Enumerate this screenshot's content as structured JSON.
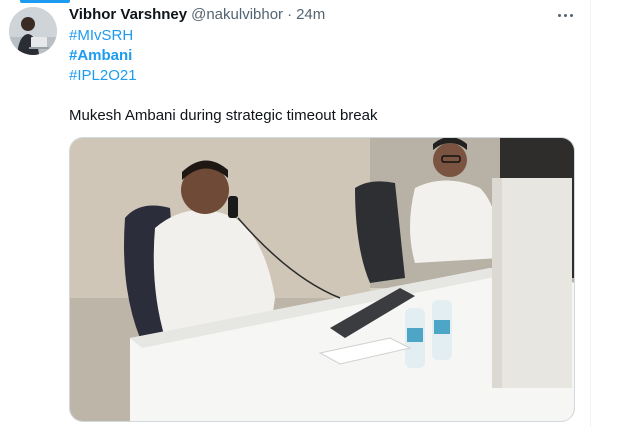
{
  "tweet": {
    "author": {
      "display_name": "Vibhor Varshney",
      "handle": "@nakulvibhor",
      "avatar_icon": "user-avatar"
    },
    "separator": "·",
    "time": "24m",
    "hashtags": [
      "#MIvSRH",
      "#Ambani",
      "#IPL2O21"
    ],
    "text": "Mukesh Ambani during strategic timeout break",
    "more_icon": "more-horizontal-icon",
    "media": {
      "kind": "photo"
    }
  },
  "colors": {
    "accent": "#1d9bf0",
    "text": "#0f1419",
    "secondary": "#536471",
    "border": "#cfd9de"
  }
}
